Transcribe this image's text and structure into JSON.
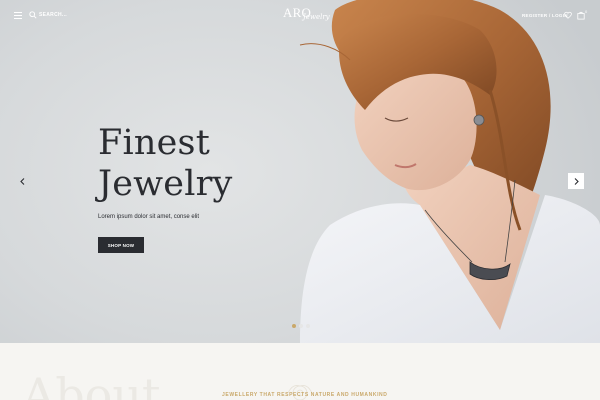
{
  "header": {
    "search_label": "SEARCH...",
    "logo_main": "ARO",
    "logo_script": "Jewelry",
    "register_label": "REGISTER / LOGIN",
    "cart_count": "0"
  },
  "icons": {
    "menu": "hamburger-icon",
    "search": "search-icon",
    "wishlist": "heart-icon",
    "cart": "shopping-bag-icon",
    "prev": "chevron-left-icon",
    "next": "chevron-right-icon"
  },
  "hero": {
    "title_line1": "Finest",
    "title_line2": "Jewelry",
    "subtitle": "Lorem ipsum dolor sit amet, conse elit",
    "cta_label": "SHOP NOW",
    "slides_total": 3,
    "active_slide": 1
  },
  "about": {
    "heading": "About",
    "tagline": "JEWELLERY THAT RESPECTS NATURE AND HUMANKIND"
  },
  "colors": {
    "dark": "#2a2c31",
    "accent": "#c9a86a",
    "hero_bg": "#d6d9db",
    "section_bg": "#f6f5f2",
    "dot_active": "#c9a86a",
    "dot_inactive": "#e6e6e6"
  }
}
